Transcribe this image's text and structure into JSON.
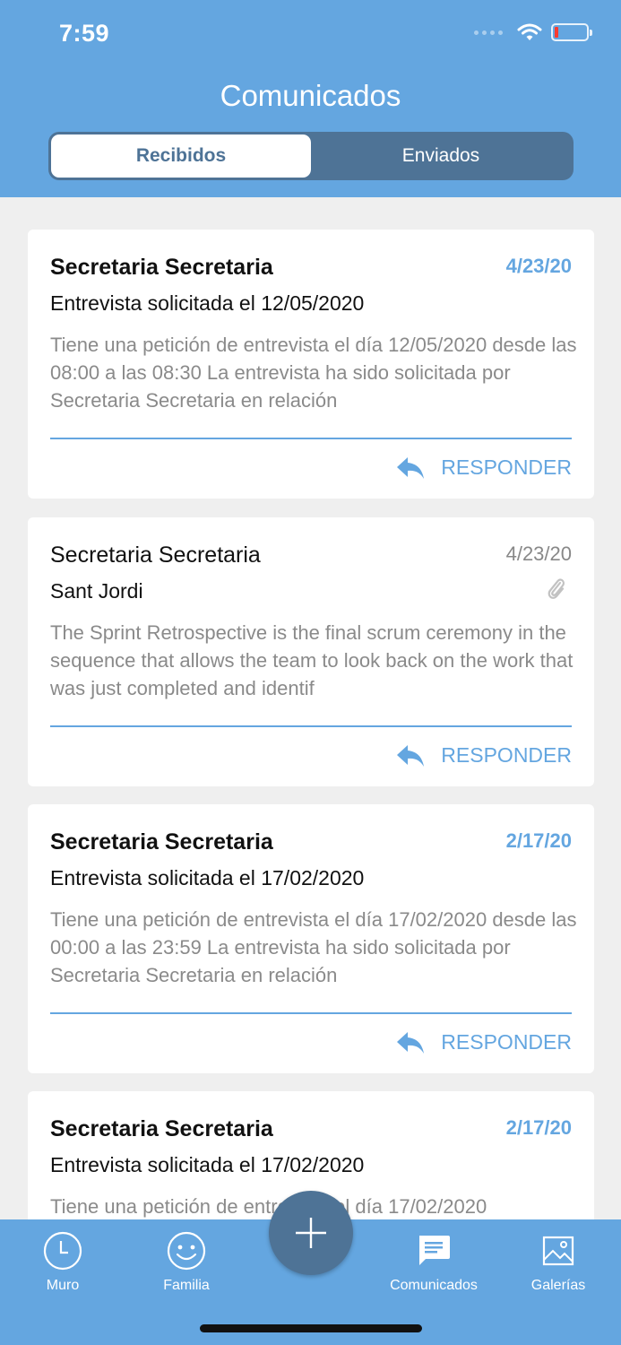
{
  "status": {
    "time": "7:59"
  },
  "header": {
    "title": "Comunicados",
    "tabs": [
      {
        "label": "Recibidos",
        "selected": true
      },
      {
        "label": "Enviados",
        "selected": false
      }
    ]
  },
  "messages": [
    {
      "from": "Secretaria Secretaria",
      "date": "4/23/20",
      "subject": "Entrevista solicitada el 12/05/2020",
      "preview": "Tiene una petición de entrevista el día 12/05/2020 desde las 08:00 a las 08:30 La entrevista ha sido solicitada por Secretaria Secretaria en relación",
      "unread": true,
      "attachment": false,
      "reply_label": "RESPONDER"
    },
    {
      "from": "Secretaria Secretaria",
      "date": "4/23/20",
      "subject": "Sant Jordi",
      "preview": "The Sprint Retrospective is the final scrum ceremony in the sequence that allows the team to look back on the work that was just completed and identif",
      "unread": false,
      "attachment": true,
      "reply_label": "RESPONDER"
    },
    {
      "from": "Secretaria Secretaria",
      "date": "2/17/20",
      "subject": "Entrevista solicitada el 17/02/2020",
      "preview": "Tiene una petición de entrevista el día 17/02/2020 desde las 00:00 a las 23:59 La entrevista ha sido solicitada por Secretaria Secretaria en relación",
      "unread": true,
      "attachment": false,
      "reply_label": "RESPONDER"
    },
    {
      "from": "Secretaria Secretaria",
      "date": "2/17/20",
      "subject": "Entrevista solicitada el 17/02/2020",
      "preview": "Tiene una petición de entrevista el día 17/02/2020",
      "unread": true,
      "attachment": false
    }
  ],
  "tabbar": {
    "items": [
      {
        "label": "Muro",
        "icon": "clock-icon"
      },
      {
        "label": "Familia",
        "icon": "smiley-icon"
      },
      {
        "label": "Comunicados",
        "icon": "chat-icon"
      },
      {
        "label": "Galerías",
        "icon": "image-icon"
      }
    ],
    "fab_icon": "plus-icon"
  },
  "colors": {
    "primary": "#64a6e0",
    "dark": "#4e7396",
    "background": "#efefef"
  }
}
